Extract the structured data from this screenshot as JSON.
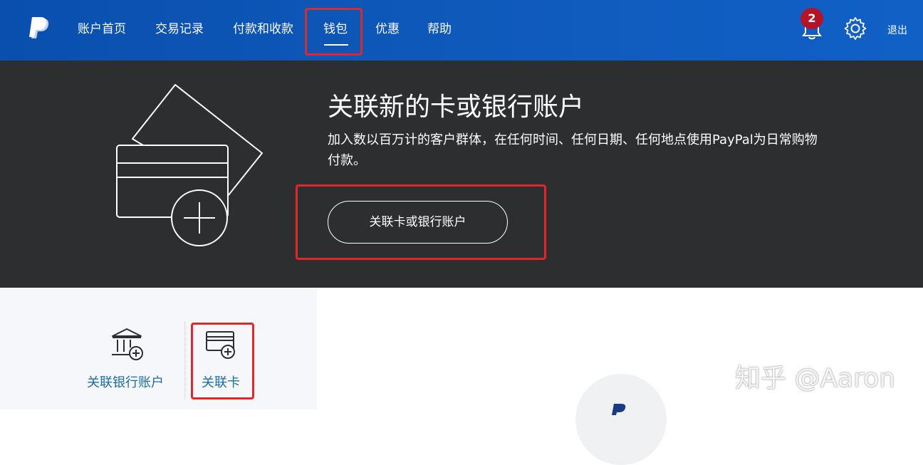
{
  "nav": {
    "items": [
      {
        "label": "账户首页"
      },
      {
        "label": "交易记录"
      },
      {
        "label": "付款和收款"
      },
      {
        "label": "钱包"
      },
      {
        "label": "优惠"
      },
      {
        "label": "帮助"
      }
    ],
    "active": "钱包",
    "notification_count": "2",
    "logout_label": "退出"
  },
  "banner": {
    "title": "关联新的卡或银行账户",
    "description": "加入数以百万计的客户群体，在任何时间、任何日期、任何地点使用PayPal为日常购物付款。",
    "button_label": "关联卡或银行账户"
  },
  "options": {
    "bank_label": "关联银行账户",
    "card_label": "关联卡"
  },
  "watermark": "知乎 @Aaron",
  "colors": {
    "nav_bg": "#0f5bbd",
    "banner_bg": "#2c2e2f",
    "highlight": "#e3262b",
    "link": "#1b6fa8",
    "badge": "#b51426"
  },
  "icons": [
    "paypal-logo-icon",
    "bell-icon",
    "gear-icon",
    "card-plus-illustration",
    "bank-plus-icon",
    "card-plus-icon"
  ]
}
